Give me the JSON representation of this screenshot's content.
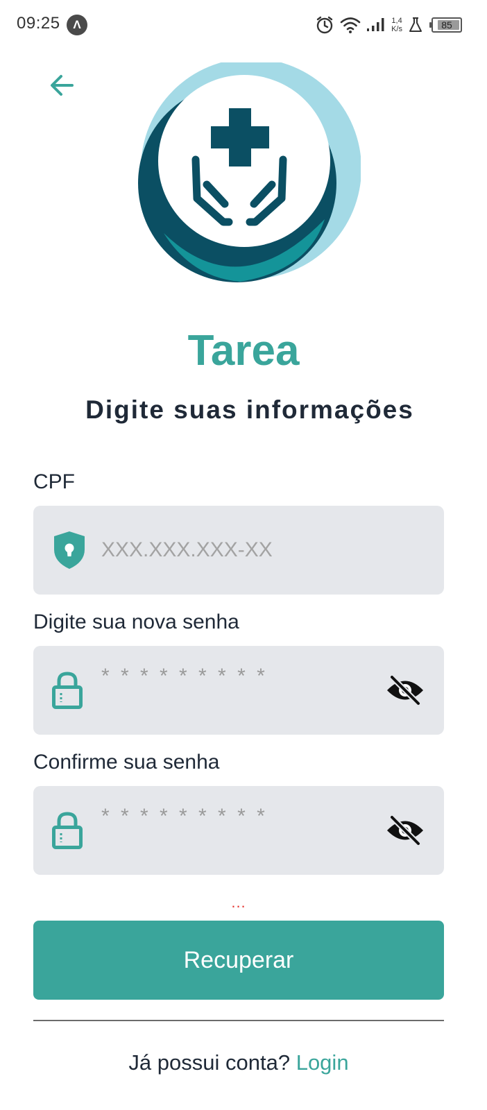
{
  "status_bar": {
    "time": "09:25",
    "app_indicator": "Λ",
    "net_speed_value": "1,4",
    "net_speed_unit": "K/s",
    "battery_percent": 85,
    "battery_label": "85",
    "icons": [
      "alarm-icon",
      "wifi-icon",
      "signal-icon",
      "lab-flask-icon",
      "battery-icon"
    ]
  },
  "header": {
    "back_icon": "arrow-left-icon",
    "app_name": "Tarea",
    "subtitle": "Digite suas informações"
  },
  "form": {
    "cpf": {
      "label": "CPF",
      "placeholder": "XXX.XXX.XXX-XX",
      "icon": "shield-keyhole-icon"
    },
    "new_password": {
      "label": "Digite sua nova senha",
      "placeholder": "* * * * * * * * *",
      "icon": "padlock-icon",
      "toggle_icon": "eye-off-icon"
    },
    "confirm_password": {
      "label": "Confirme sua senha",
      "placeholder": "* * * * * * * * *",
      "icon": "padlock-icon",
      "toggle_icon": "eye-off-icon"
    },
    "status_text": "...",
    "submit_label": "Recuperar"
  },
  "footer": {
    "question": "Já possui conta?",
    "link_label": "Login"
  },
  "colors": {
    "accent": "#3aa59b",
    "dark_teal": "#0b4f63",
    "light_teal": "#a4dae6",
    "field_bg": "#e5e7eb",
    "text": "#1f2937",
    "error": "#e53935"
  }
}
